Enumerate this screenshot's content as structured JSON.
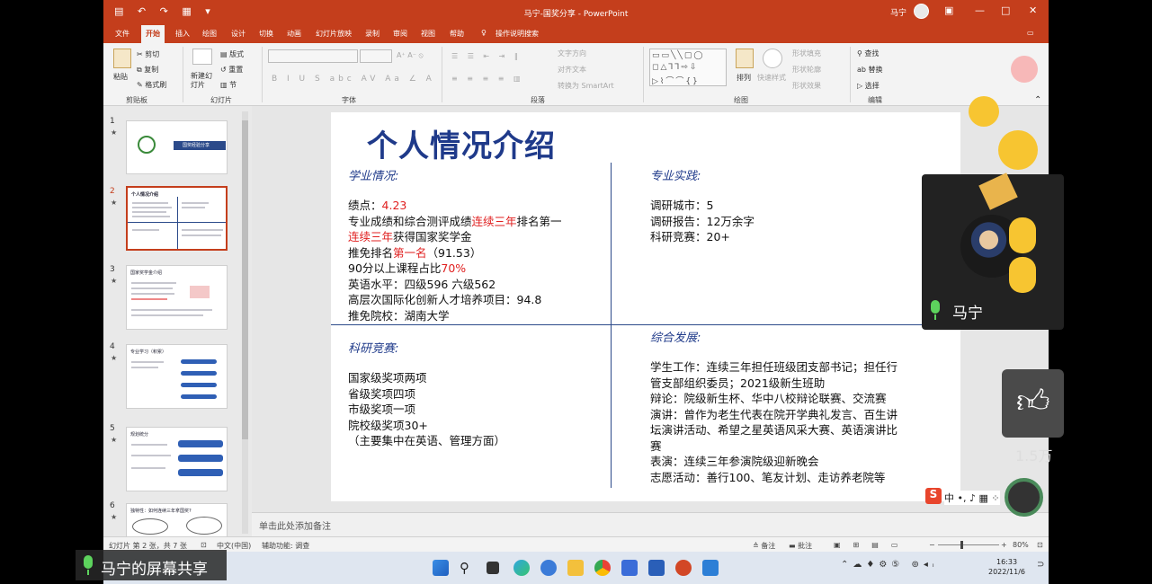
{
  "window": {
    "title": "马宁-国奖分享 - PowerPoint",
    "user": "马宁",
    "buttons": [
      "—",
      "□",
      "✕"
    ]
  },
  "ribbon_tabs": [
    "文件",
    "开始",
    "插入",
    "绘图",
    "设计",
    "切换",
    "动画",
    "幻灯片放映",
    "录制",
    "审阅",
    "视图",
    "帮助"
  ],
  "active_tab": "开始",
  "tell_me": "操作说明搜索",
  "ribbon": {
    "clipboard": {
      "paste": "粘贴",
      "cut": "剪切",
      "copy": "复制",
      "format_painter": "格式刷",
      "label": "剪贴板"
    },
    "slides": {
      "new_slide": "新建幻灯片",
      "layout": "版式",
      "reset": "重置",
      "section": "节",
      "label": "幻灯片"
    },
    "font": {
      "label": "字体"
    },
    "paragraph": {
      "text_direction": "文字方向",
      "align_text": "对齐文本",
      "smartart": "转换为 SmartArt",
      "label": "段落"
    },
    "drawing": {
      "arrange": "排列",
      "quick_styles": "快速样式",
      "shape_fill": "形状填充",
      "shape_outline": "形状轮廓",
      "shape_effects": "形状效果",
      "label": "绘图"
    },
    "editing": {
      "find": "查找",
      "replace": "替换",
      "select": "选择",
      "label": "编辑"
    }
  },
  "thumbnails": [
    {
      "num": "1",
      "title": "国奖经验分享"
    },
    {
      "num": "2",
      "title": "个人情况介绍",
      "selected": true
    },
    {
      "num": "3",
      "title": "国家奖学金介绍"
    },
    {
      "num": "4",
      "title": "专业学习（积累）"
    },
    {
      "num": "5",
      "title": "规划统分"
    },
    {
      "num": "6",
      "title": "独特性：如何连续三年拿国奖?"
    }
  ],
  "slide": {
    "title": "个人情况介绍",
    "academic": {
      "heading": "学业情况:",
      "gpa_label": "绩点：",
      "gpa_value": "4.23",
      "line2_a": "专业成绩和综合测评成绩",
      "line2_b": "连续三年",
      "line2_c": "排名第一",
      "line3_a": "连续三年",
      "line3_b": "获得国家奖学金",
      "line4_a": "推免排名",
      "line4_b": "第一名",
      "line4_c": "（91.53）",
      "line5_a": "90分以上课程占比",
      "line5_b": "70%",
      "line6": "英语水平：四级596 六级562",
      "line7": "高层次国际化创新人才培养项目：94.8",
      "line8": "推免院校：湖南大学"
    },
    "practice": {
      "heading": "专业实践:",
      "lines": [
        "调研城市：5",
        "调研报告：12万余字",
        "科研竞赛：20+"
      ]
    },
    "competitions": {
      "heading": "科研竞赛:",
      "lines": [
        "国家级奖项两项",
        "省级奖项四项",
        "市级奖项一项",
        "院校级奖项30+",
        "（主要集中在英语、管理方面）"
      ]
    },
    "development": {
      "heading": "综合发展:",
      "lines": [
        "学生工作：连续三年担任班级团支部书记；担任行",
        "管支部组织委员；2021级新生班助",
        "辩论：院级新生杯、华中八校辩论联赛、交流赛",
        "演讲：曾作为老生代表在院开学典礼发言、百生讲",
        "坛演讲活动、希望之星英语风采大赛、英语演讲比",
        "赛",
        "表演：连续三年参演院级迎新晚会",
        "志愿活动：善行100、笔友计划、走访养老院等"
      ]
    }
  },
  "notes_placeholder": "单击此处添加备注",
  "status": {
    "slide_info": "幻灯片 第 2 张，共 7 张",
    "language": "中文(中国)",
    "accessibility": "辅助功能: 调查",
    "notes": "备注",
    "comments": "批注",
    "zoom": "80%"
  },
  "taskbar": {
    "time": "16:33",
    "date": "2022/11/6"
  },
  "meeting": {
    "screen_share_label": "马宁的屏幕共享",
    "participant_name": "马宁",
    "like_count": "1.5万"
  },
  "colors": {
    "accent": "#c43e1c",
    "slide_title": "#1f3a8a",
    "highlight": "#e02020"
  }
}
